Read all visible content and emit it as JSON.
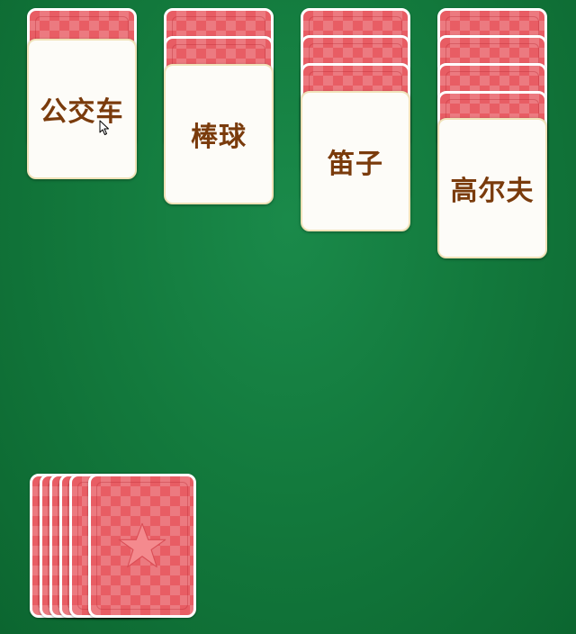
{
  "game": {
    "piles": [
      {
        "hidden_count": 1,
        "face_word": "公交车"
      },
      {
        "hidden_count": 2,
        "face_word": "棒球"
      },
      {
        "hidden_count": 3,
        "face_word": "笛子"
      },
      {
        "hidden_count": 4,
        "face_word": "高尔夫"
      }
    ],
    "stock": {
      "card_count": 6
    }
  },
  "colors": {
    "table_green": "#137a3d",
    "card_back_red": "#e85d64",
    "card_face": "#fdfcf8",
    "word_brown": "#7a3b0c"
  },
  "icons": {
    "stock_emblem": "star-icon",
    "pointer": "mouse-cursor-icon"
  }
}
